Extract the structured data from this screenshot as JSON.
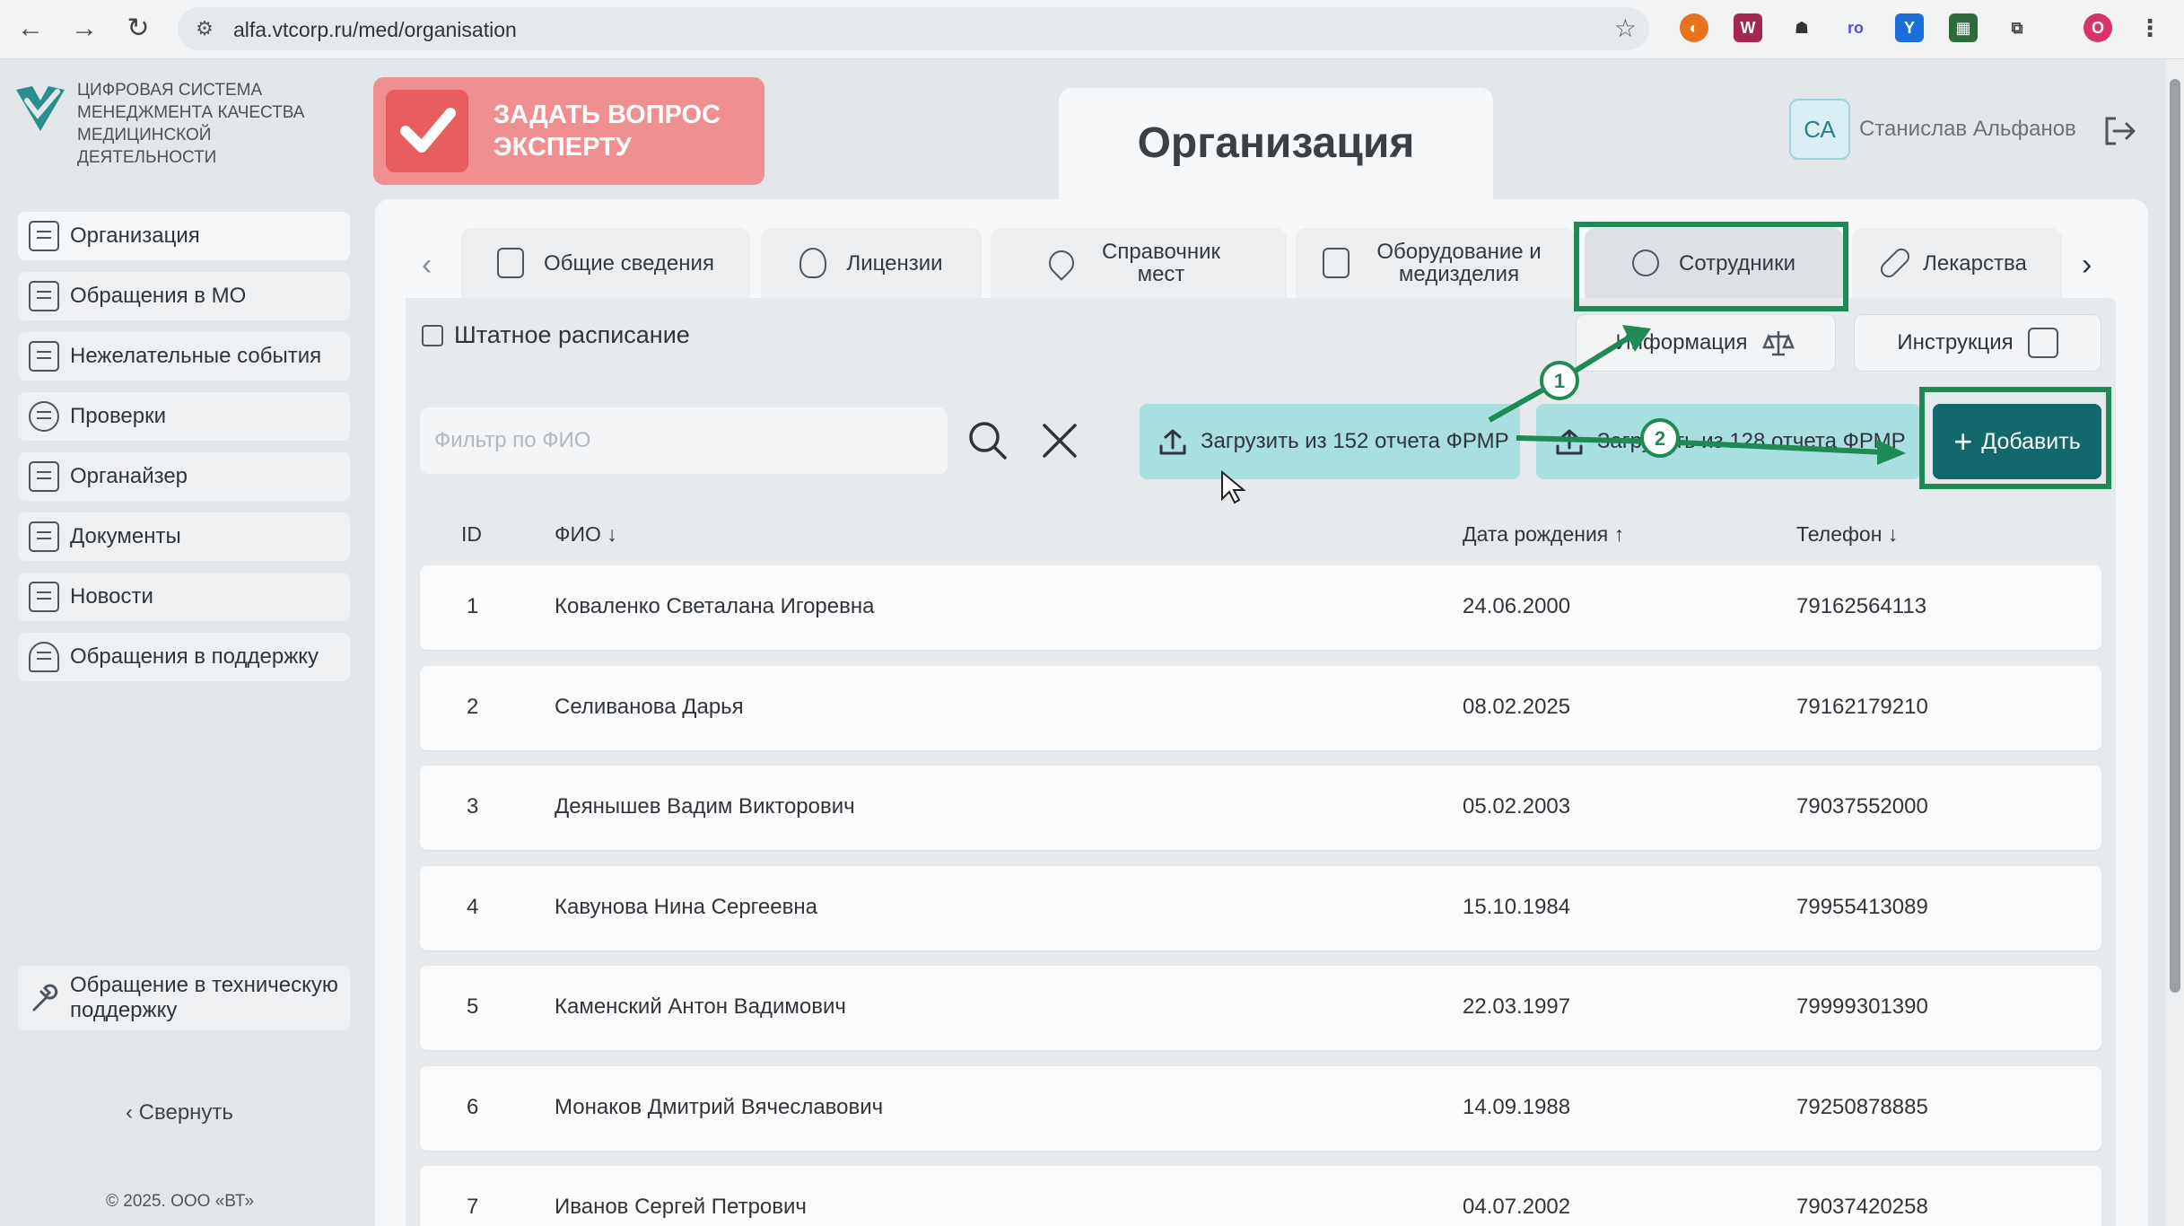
{
  "browser": {
    "url": "alfa.vtcorp.ru/med/organisation",
    "extensions": [
      {
        "name": "ext-circle-icon",
        "color": "#e8731f",
        "glyph": "◐"
      },
      {
        "name": "ext-w-icon",
        "color": "#a3274f",
        "glyph": "W"
      },
      {
        "name": "ext-spy-icon",
        "color": "#3a3a3a",
        "glyph": "☗"
      },
      {
        "name": "ext-ro-icon",
        "color": "#ffffff",
        "glyph": "ro"
      },
      {
        "name": "ext-y-icon",
        "color": "#1b6fd9",
        "glyph": "Y"
      },
      {
        "name": "ext-grid-icon",
        "color": "#2e6b3a",
        "glyph": "▦"
      },
      {
        "name": "ext-puzzle-icon",
        "color": "#ffffff",
        "glyph": "⧉"
      },
      {
        "name": "profile-icon",
        "color": "#d9336c",
        "glyph": "O"
      }
    ]
  },
  "sidebar": {
    "logo_text": "ЦИФРОВАЯ СИСТЕМА МЕНЕДЖМЕНТА КАЧЕСТВА МЕДИЦИНСКОЙ ДЕЯТЕЛЬНОСТИ",
    "items": [
      {
        "label": "Организация"
      },
      {
        "label": "Обращения в МО"
      },
      {
        "label": "Нежелательные события"
      },
      {
        "label": "Проверки"
      },
      {
        "label": "Органайзер"
      },
      {
        "label": "Документы"
      },
      {
        "label": "Новости"
      },
      {
        "label": "Обращения в поддержку"
      }
    ],
    "support_label": "Обращение в техническую поддержку",
    "collapse_label": "Свернуть",
    "copyright": "© 2025. ООО «ВТ»"
  },
  "header": {
    "ask_expert": "ЗАДАТЬ ВОПРОС ЭКСПЕРТУ",
    "page_title": "Организация",
    "user_initials": "СА",
    "user_name": "Станислав  Альфанов"
  },
  "tabs": [
    {
      "label": "Общие сведения"
    },
    {
      "label": "Лицензии"
    },
    {
      "label": "Справочник мест"
    },
    {
      "label": "Оборудование и медизделия"
    },
    {
      "label": "Сотрудники"
    },
    {
      "label": "Лекарства"
    }
  ],
  "staff": {
    "title": "Штатное расписание",
    "info_label": "Информация",
    "instruction_label": "Инструкция",
    "filter_placeholder": "Фильтр по ФИО",
    "upload152_label": "Загрузить из 152 отчета ФРМР",
    "upload128_label": "Загрузить из 128 отчета ФРМР",
    "add_label": "Добавить"
  },
  "table": {
    "headers": {
      "id": "ID",
      "fio": "ФИО ↓",
      "birth": "Дата рождения ↑",
      "phone": "Телефон ↓"
    },
    "rows": [
      {
        "id": "1",
        "fio": "Коваленко Светалана Игоревна",
        "birth": "24.06.2000",
        "phone": "79162564113"
      },
      {
        "id": "2",
        "fio": "Селиванова Дарья",
        "birth": "08.02.2025",
        "phone": "79162179210"
      },
      {
        "id": "3",
        "fio": "Деянышев Вадим Викторович",
        "birth": "05.02.2003",
        "phone": "79037552000"
      },
      {
        "id": "4",
        "fio": "Кавунова Нина Сергеевна",
        "birth": "15.10.1984",
        "phone": "79955413089"
      },
      {
        "id": "5",
        "fio": "Каменский Антон Вадимович",
        "birth": "22.03.1997",
        "phone": "79999301390"
      },
      {
        "id": "6",
        "fio": "Монаков Дмитрий Вячеславович",
        "birth": "14.09.1988",
        "phone": "79250878885"
      },
      {
        "id": "7",
        "fio": "Иванов Сергей Петрович",
        "birth": "04.07.2002",
        "phone": "79037420258"
      }
    ]
  },
  "annotations": {
    "marker_1": "1",
    "marker_2": "2",
    "color": "#1e8a55"
  }
}
